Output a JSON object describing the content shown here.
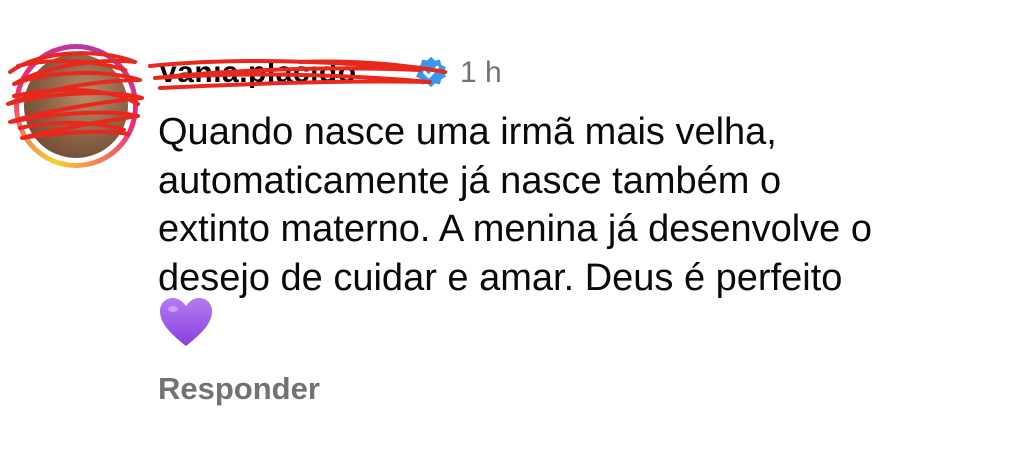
{
  "comment": {
    "username": "vania.placido",
    "verified_icon": "verified-badge-icon",
    "timestamp": "1 h",
    "text_lines": [
      "Quando nasce uma irmã mais velha,",
      "automaticamente já nasce também o",
      "extinto materno. A menina já desenvolve o",
      "desejo de cuidar e amar. Deus é perfeito"
    ],
    "emoji": "purple-heart-icon",
    "reply_label": "Responder"
  },
  "colors": {
    "verified_blue": "#3897f0",
    "muted_text": "#737373",
    "heart_purple": "#9b59e6",
    "redaction_red": "#e8281d"
  }
}
